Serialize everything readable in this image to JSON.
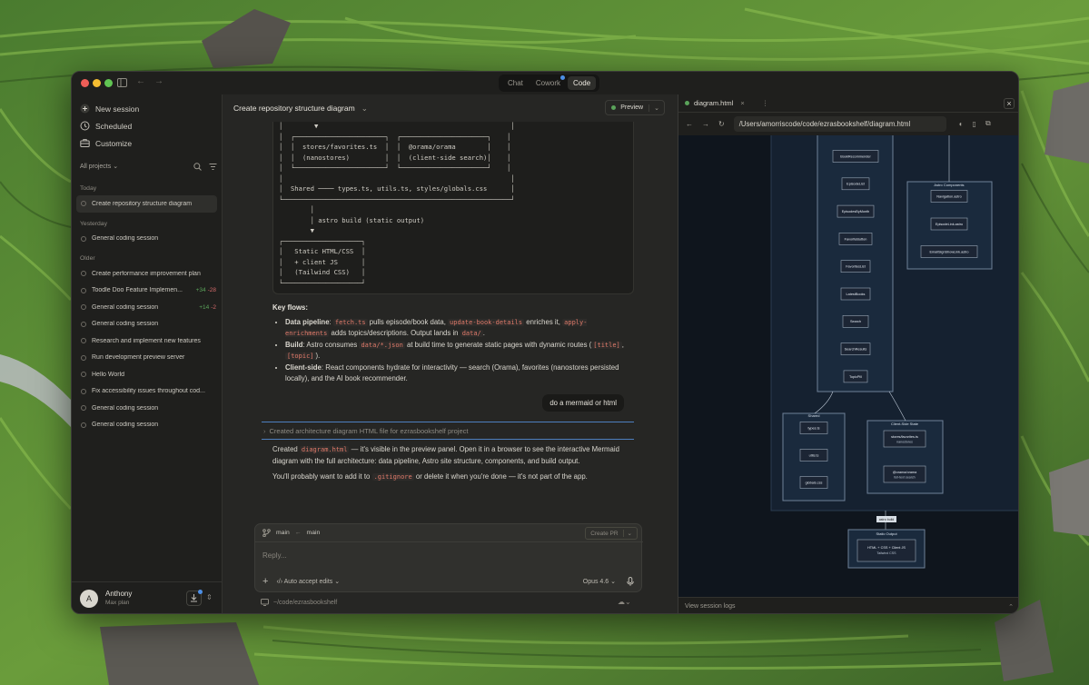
{
  "titlebar": {
    "modes": [
      {
        "label": "Chat",
        "active": false
      },
      {
        "label": "Cowork",
        "active": false,
        "badge": true
      },
      {
        "label": "Code",
        "active": true
      }
    ]
  },
  "sidebar": {
    "new_session": "New session",
    "scheduled": "Scheduled",
    "customize": "Customize",
    "filter": "All projects",
    "sections": [
      {
        "label": "Today",
        "items": [
          {
            "title": "Create repository structure diagram",
            "active": true
          }
        ]
      },
      {
        "label": "Yesterday",
        "items": [
          {
            "title": "General coding session"
          }
        ]
      },
      {
        "label": "Older",
        "items": [
          {
            "title": "Create performance improvement plan"
          },
          {
            "title": "Toodle Doo Feature Implemen...",
            "added": "+34",
            "removed": "-28"
          },
          {
            "title": "General coding session",
            "added": "+14",
            "removed": "-2"
          },
          {
            "title": "General coding session"
          },
          {
            "title": "Research and implement new features"
          },
          {
            "title": "Run development preview server"
          },
          {
            "title": "Hello World"
          },
          {
            "title": "Fix accessibility issues throughout cod..."
          },
          {
            "title": "General coding session"
          },
          {
            "title": "General coding session"
          }
        ]
      }
    ],
    "user": {
      "initial": "A",
      "name": "Anthony",
      "plan": "Max plan"
    }
  },
  "chat": {
    "title": "Create repository structure diagram",
    "preview_label": "Preview",
    "code_lines": [
      "│        ▼                                                 │",
      "│  ┌───────────────────────┐  ┌──────────────────────┐    │",
      "│  │  stores/favorites.ts  │  │  @orama/orama        │    │",
      "│  │  (nanostores)         │  │  (client-side search)│    │",
      "│  └───────────────────────┘  └──────────────────────┘    │",
      "│                                                          │",
      "│  Shared ──── types.ts, utils.ts, styles/globals.css      │",
      "└──────────────────────────────────────────────────────────┘",
      "        │",
      "        │ astro build (static output)",
      "        ▼",
      "┌────────────────────┐",
      "│   Static HTML/CSS  │",
      "│   + client JS      │",
      "│   (Tailwind CSS)   │",
      "└────────────────────┘"
    ],
    "key_flows_heading": "Key flows:",
    "flows": {
      "pipeline_label": "Data pipeline",
      "fetch": "fetch.ts",
      "pipeline_t1": " pulls episode/book data, ",
      "update": "update-book-details",
      "pipeline_t2": " enriches it, ",
      "apply": "apply-enrichments",
      "pipeline_t3": " adds topics/descriptions. Output lands in ",
      "data_dir": "data/",
      "pipeline_t4": ".",
      "build_label": "Build",
      "build_t1": ": Astro consumes ",
      "data_json": "data/*.json",
      "build_t2": " at build time to generate static pages with dynamic routes (",
      "title_route": "[title]",
      "comma": ", ",
      "topic_route": "[topic]",
      "build_t3": ").",
      "client_label": "Client-side",
      "client_text": ": React components hydrate for interactivity — search (Orama), favorites (nanostores persisted locally), and the AI book recommender."
    },
    "user_message": "do a mermaid or html",
    "tool_line": "Created architecture diagram HTML file for ezrasbookshelf project",
    "reply": {
      "p1_a": "Created ",
      "p1_file": "diagram.html",
      "p1_b": " — it's visible in the preview panel. Open it in a browser to see the interactive Mermaid diagram with the full architecture: data pipeline, Astro site structure, components, and build output.",
      "p2_a": "You'll probably want to add it to ",
      "p2_file": ".gitignore",
      "p2_b": " or delete it when you're done — it's not part of the app."
    }
  },
  "composer": {
    "branch_from": "main",
    "branch_to": "main",
    "create_pr": "Create PR",
    "placeholder": "Reply...",
    "auto_accept": "Auto accept edits",
    "model": "Opus 4.6",
    "path": "~/code/ezrasbookshelf"
  },
  "preview": {
    "tab_name": "diagram.html",
    "url": "/Users/amorriscode/code/ezrasbookshelf/diagram.html",
    "footer": "View session logs",
    "diagram": {
      "main_nodes": [
        "BookRecommender",
        "EpisodeList",
        "EpisodesByMonth",
        "FavoriteButton",
        "FavoritesList",
        "LatestBooks",
        "Search",
        "SearchResults",
        "TopicPill"
      ],
      "astro_title": "Astro Components",
      "astro_nodes": [
        "Navigation.astro",
        "EpisodeLink.astro",
        "EmailSignShowLink.astro"
      ],
      "shared_title": "Shared",
      "shared_nodes": [
        "types.ts",
        "utils.ts",
        "globals.css"
      ],
      "client_title": "Client-Side State",
      "client_nodes": [
        {
          "l1": "stores/favorites.ts",
          "l2": "nanostores"
        },
        {
          "l1": "@orama/orama",
          "l2": "full-text search"
        }
      ],
      "build_edge": "astro build",
      "static_title": "Static Output",
      "static_node": {
        "l1": "HTML + CSS + Client JS",
        "l2": "Tailwind CSS"
      }
    }
  },
  "colors": {
    "accent_blue": "#4d7fbf",
    "code_red": "#e07a6a",
    "green": "#5aa35a",
    "diagram_bg": "#0f151d"
  }
}
